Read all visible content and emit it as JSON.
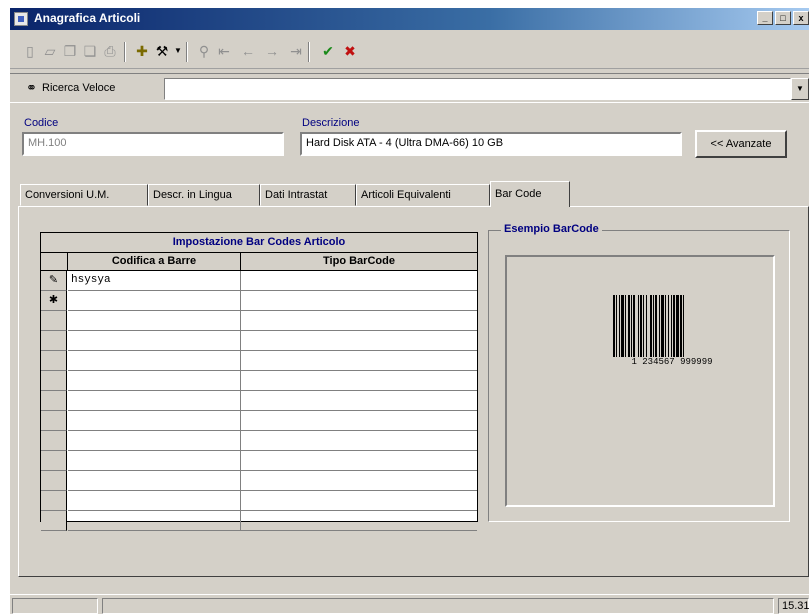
{
  "window": {
    "title": "Anagrafica Articoli",
    "controls": [
      "_",
      "□",
      "x"
    ]
  },
  "toolbar": {
    "icons": [
      "new-icon",
      "open-icon",
      "copy-icon",
      "paste-icon",
      "print-icon",
      "add-record-icon",
      "tools-icon",
      "find-icon",
      "first-icon",
      "prev-icon",
      "next-icon",
      "last-icon",
      "confirm-icon",
      "delete-icon"
    ]
  },
  "search": {
    "label": "Ricerca Veloce",
    "value": ""
  },
  "fields": {
    "codice_label": "Codice",
    "codice_value": "MH.100",
    "descrizione_label": "Descrizione",
    "descrizione_value": "Hard Disk ATA - 4 (Ultra DMA-66) 10 GB",
    "avanzate_label": "<< Avanzate"
  },
  "tabs": [
    {
      "label": "Conversioni U.M."
    },
    {
      "label": "Descr. in Lingua"
    },
    {
      "label": "Dati Intrastat"
    },
    {
      "label": "Articoli Equivalenti"
    },
    {
      "label": "Bar Code"
    }
  ],
  "grid": {
    "caption": "Impostazione Bar Codes Articolo",
    "columns": [
      "Codifica a Barre",
      "Tipo BarCode"
    ],
    "rows": [
      {
        "marker": "✎",
        "codifica": "hsysya",
        "tipo": ""
      },
      {
        "marker": "✱",
        "codifica": "",
        "tipo": ""
      },
      {
        "marker": "",
        "codifica": "",
        "tipo": ""
      },
      {
        "marker": "",
        "codifica": "",
        "tipo": ""
      },
      {
        "marker": "",
        "codifica": "",
        "tipo": ""
      },
      {
        "marker": "",
        "codifica": "",
        "tipo": ""
      },
      {
        "marker": "",
        "codifica": "",
        "tipo": ""
      },
      {
        "marker": "",
        "codifica": "",
        "tipo": ""
      },
      {
        "marker": "",
        "codifica": "",
        "tipo": ""
      },
      {
        "marker": "",
        "codifica": "",
        "tipo": ""
      },
      {
        "marker": "",
        "codifica": "",
        "tipo": ""
      },
      {
        "marker": "",
        "codifica": "",
        "tipo": ""
      },
      {
        "marker": "",
        "codifica": "",
        "tipo": ""
      }
    ]
  },
  "example": {
    "legend": "Esempio BarCode",
    "digits": "1 234567 999999"
  },
  "status": {
    "time": "15.31"
  }
}
